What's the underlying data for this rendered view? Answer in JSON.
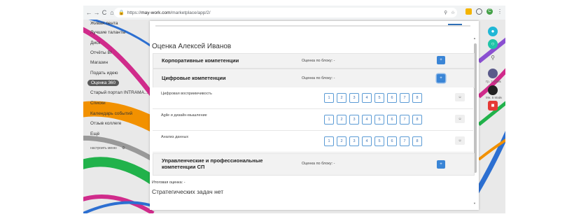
{
  "browser": {
    "nav": [
      "←",
      "→",
      "C",
      "⌂"
    ],
    "url_proto": "https://",
    "url_host": "may-work.com",
    "url_path": "/marketplace/app/2/",
    "profile": "C"
  },
  "sidebar": {
    "items": [
      "Живая лента",
      "Лучшие таланты",
      "Диск",
      "Отчёты BI",
      "Магазин",
      "Подать идею",
      "Оценка 360",
      "Старый портал INTRAMA...",
      "Списки",
      "Календарь событий",
      "Отзыв коллеге",
      "Ещё",
      "настроить меню"
    ]
  },
  "rail": {
    "user1": "Гр. 7 Майк",
    "user2": "Мн. 8 Майк"
  },
  "modal": {
    "title": "Оценка Алексей Иванов",
    "plus": "+",
    "sections": [
      {
        "title": "Корпоративные компетенции",
        "score": "Оценка по блоку: -"
      },
      {
        "title": "Цифровые компетенции",
        "score": "Оценка по блоку: -"
      },
      {
        "title": "Управленческие и профессиональные компетенции СП",
        "score": "Оценка по блоку: -"
      }
    ],
    "rows": [
      {
        "label": "Цифровая восприимчивость"
      },
      {
        "label": "Agile и дизайн-мышление"
      },
      {
        "label": "Анализ данных"
      }
    ],
    "rating_values": [
      "1",
      "2",
      "3",
      "4",
      "5",
      "6",
      "7",
      "8"
    ],
    "comment_icon": "☺",
    "total": "Итоговая оценка: -",
    "strategic": "Стратегических задач нет"
  }
}
